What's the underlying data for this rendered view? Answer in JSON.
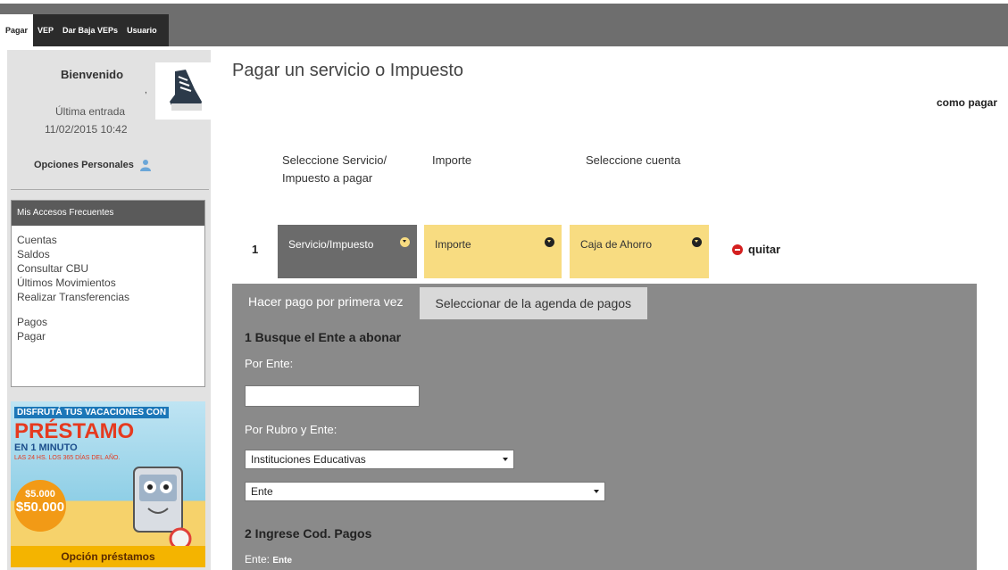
{
  "topbar": {
    "tabs": [
      {
        "label": "Pagar"
      },
      {
        "label": "VEP"
      },
      {
        "label": "Dar Baja VEPs"
      },
      {
        "label": "Usuario"
      }
    ]
  },
  "sidebar": {
    "welcome": "Bienvenido",
    "user_dot": ",",
    "last_login_label": "Última entrada",
    "last_login_date": "11/02/2015 10:42",
    "personal_options": "Opciones Personales",
    "favorites_title": "Mis Accesos Frecuentes",
    "favorites": [
      {
        "label": "Cuentas"
      },
      {
        "label": "Saldos"
      },
      {
        "label": "Consultar CBU"
      },
      {
        "label": "Últimos Movimientos"
      },
      {
        "label": "Realizar Transferencias"
      },
      {
        "label": "Pagos"
      },
      {
        "label": "Pagar"
      }
    ],
    "promo": {
      "line1": "DISFRUTÁ TUS VACACIONES CON",
      "line2": "PRÉSTAMO",
      "line3": "EN 1 MINUTO",
      "line4": "LAS 24 HS. LOS 365 DÍAS DEL AÑO.",
      "amount1": "$5.000",
      "amount2": "$50.000",
      "footer": "Opción préstamos"
    }
  },
  "main": {
    "title": "Pagar un servicio o Impuesto",
    "how_to_pay": "como pagar",
    "steps": {
      "service": "Seleccione Servicio/ Impuesto a pagar",
      "amount": "Importe",
      "account": "Seleccione cuenta"
    },
    "row": {
      "number": "1",
      "service_select": "Servicio/Impuesto",
      "amount_select": "Importe",
      "account_select": "Caja de Ahorro",
      "remove": "quitar"
    },
    "panel": {
      "tab_first": "Hacer pago por primera vez",
      "tab_agenda": "Seleccionar de la agenda de pagos",
      "section1": "1 Busque el Ente a abonar",
      "by_entity": "Por Ente:",
      "entity_input_value": "",
      "by_category": "Por Rubro y Ente:",
      "category_select": "Instituciones Educativas",
      "entity_select": "Ente",
      "section2": "2 Ingrese Cod. Pagos",
      "ente_label": "Ente:",
      "ente_value": "Ente"
    }
  }
}
